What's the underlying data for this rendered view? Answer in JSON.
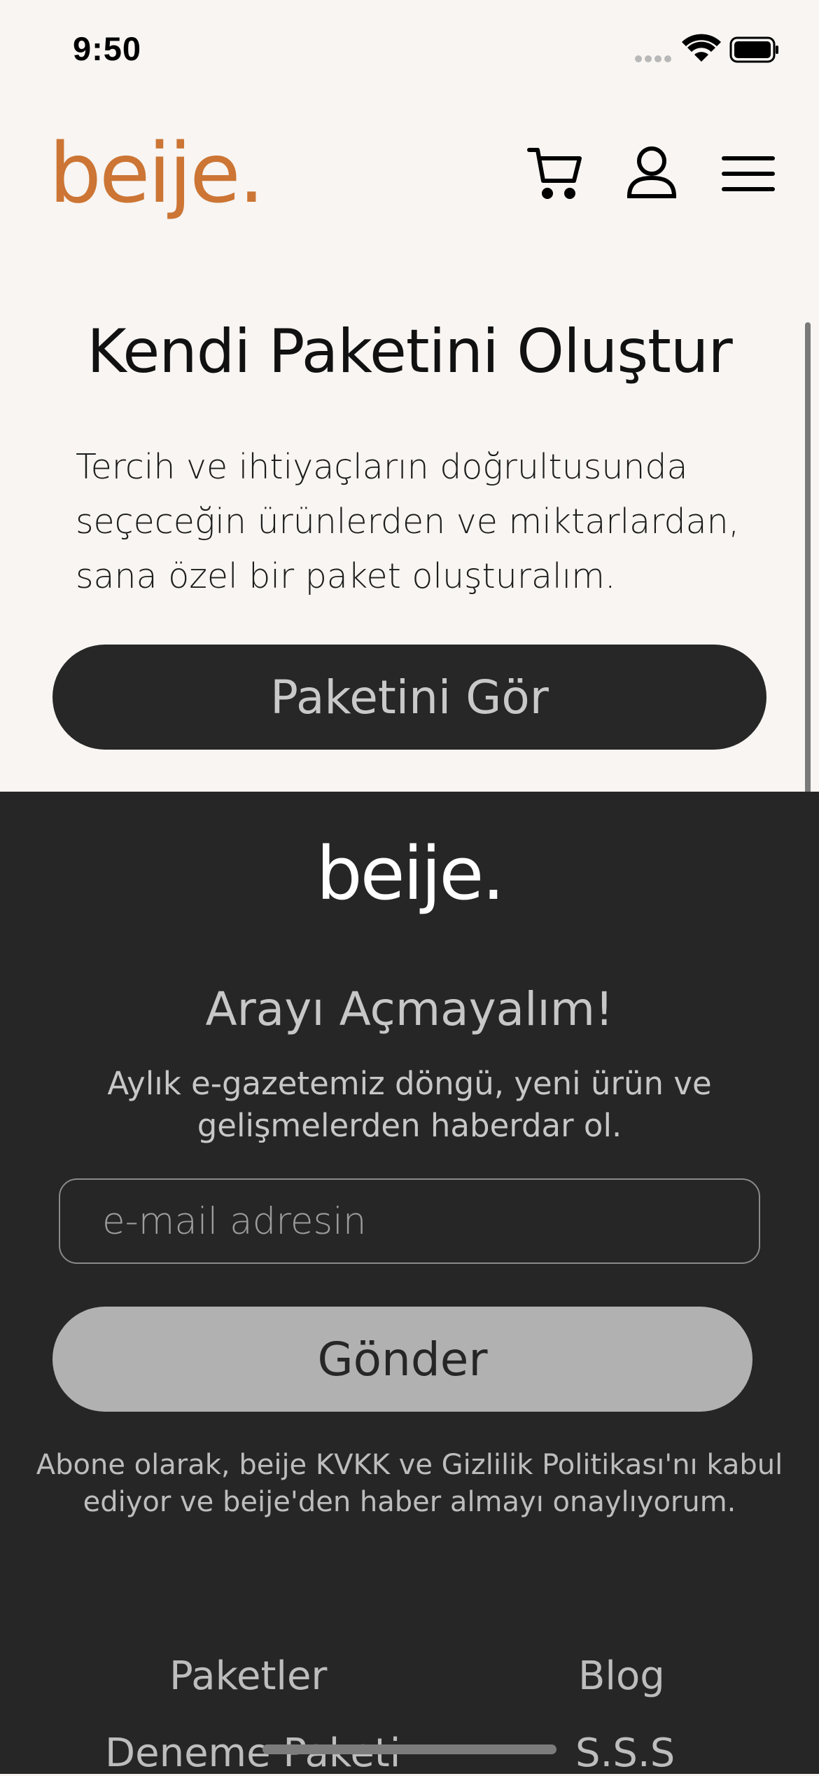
{
  "status_bar": {
    "time": "9:50"
  },
  "header": {
    "logo": "beije.",
    "icons": [
      "cart-icon",
      "user-icon",
      "menu-icon"
    ]
  },
  "hero": {
    "title": "Kendi Paketini Oluştur",
    "description": "Tercih ve ihtiyaçların doğrultusunda seçeceğin ürünlerden ve miktarlardan, sana özel bir paket oluşturalım.",
    "button_label": "Paketini Gör"
  },
  "footer": {
    "logo": "beije.",
    "newsletter": {
      "title": "Arayı Açmayalım!",
      "description": "Aylık e-gazetemiz döngü, yeni ürün ve gelişmelerden haberdar ol.",
      "email_placeholder": "e-mail adresin",
      "send_label": "Gönder",
      "consent": "Abone olarak, beije KVKK ve Gizlilik Politikası'nı kabul ediyor ve beije'den haber almayı onaylıyorum."
    },
    "links": {
      "col1": [
        "Paketler",
        "Deneme Paketi"
      ],
      "col2": [
        "Blog",
        "S.S.S"
      ]
    }
  },
  "colors": {
    "brand": "#cc7534",
    "page_background": "#f8f5f2",
    "footer_background": "#262626",
    "dark_button": "#272727",
    "light_button": "#b1b1b1"
  }
}
